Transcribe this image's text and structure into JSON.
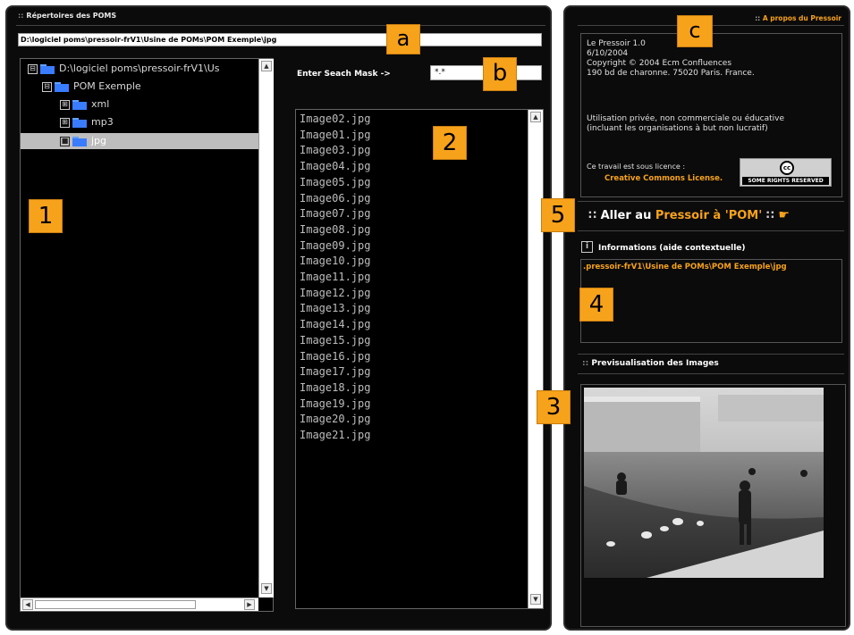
{
  "left": {
    "title": "Répertoires des POMS",
    "path_value": "D:\\logiciel poms\\pressoir-frV1\\Usine de POMs\\POM Exemple\\jpg",
    "tree": [
      {
        "label": "D:\\logiciel poms\\pressoir-frV1\\Us",
        "expander": "⊟",
        "level": 0,
        "selected": false
      },
      {
        "label": "POM Exemple",
        "expander": "⊟",
        "level": 1,
        "selected": false
      },
      {
        "label": "xml",
        "expander": "⊞",
        "level": 2,
        "selected": false
      },
      {
        "label": "mp3",
        "expander": "⊞",
        "level": 2,
        "selected": false
      },
      {
        "label": "jpg",
        "expander": "■",
        "level": 2,
        "selected": true
      }
    ],
    "mask_label": "Enter Seach Mask ->",
    "mask_value": "*.*",
    "files": [
      "Image02.jpg",
      "Image01.jpg",
      "Image03.jpg",
      "Image04.jpg",
      "Image05.jpg",
      "Image06.jpg",
      "Image07.jpg",
      "Image08.jpg",
      "Image09.jpg",
      "Image10.jpg",
      "Image11.jpg",
      "Image12.jpg",
      "Image13.jpg",
      "Image14.jpg",
      "Image15.jpg",
      "Image16.jpg",
      "Image17.jpg",
      "Image18.jpg",
      "Image19.jpg",
      "Image20.jpg",
      "Image21.jpg"
    ]
  },
  "right": {
    "about_link": "A propos du Pressoir",
    "about_lines": [
      "Le Pressoir 1.0",
      "6/10/2004",
      "Copyright © 2004 Ecm Confluences",
      "190 bd de charonne. 75020 Paris. France.",
      "",
      "Utilisation privée, non commerciale ou éducative",
      "(incluant les organisations à but non lucratif)",
      "",
      "Ce travail est sous licence :"
    ],
    "license_link": "Creative Commons License.",
    "cc_badge_text": "SOME RIGHTS RESERVED",
    "cc_logo": "cc",
    "pressoir_prefix": "Aller au ",
    "pressoir_link": "Pressoir à 'POM'",
    "info_title": "Informations (aide contextuelle)",
    "info_icon": "i",
    "info_path": ".pressoir-frV1\\Usine de POMs\\POM Exemple\\jpg",
    "preview_title": "Previsualisation des Images"
  },
  "badges": {
    "b1": "1",
    "b2": "2",
    "b3": "3",
    "b4": "4",
    "b5": "5",
    "ba": "a",
    "bb": "b",
    "bc": "c"
  },
  "colors": {
    "accent": "#f7a21b",
    "background": "#0b0b0b",
    "selected_row": "#bdbdbd",
    "folder": "#3a7cff"
  }
}
